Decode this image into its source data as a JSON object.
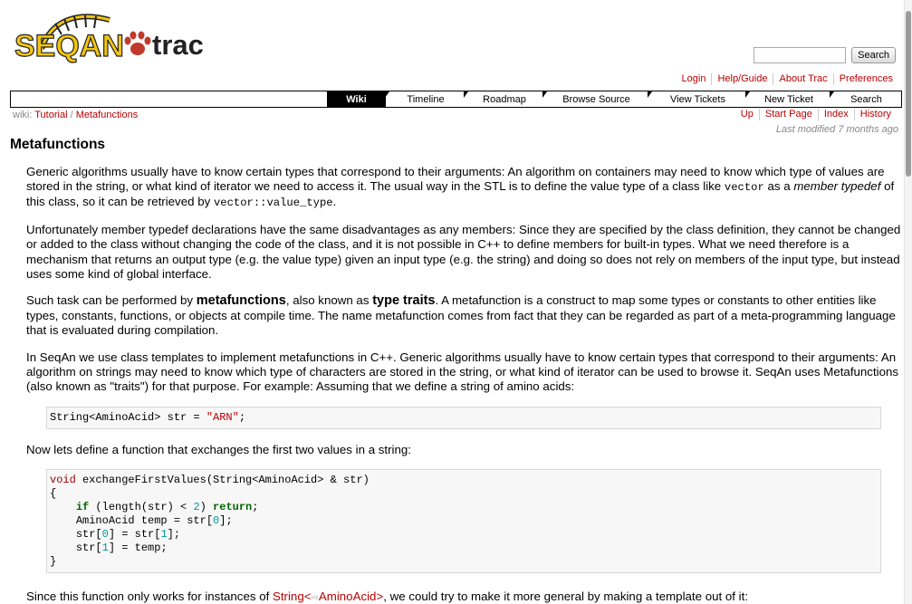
{
  "header": {
    "logo_text_seqan": "SEQAN",
    "logo_text_trac": "trac",
    "search_placeholder": "",
    "search_button": "Search"
  },
  "metanav": [
    "Login",
    "Help/Guide",
    "About Trac",
    "Preferences"
  ],
  "mainnav": [
    "Wiki",
    "Timeline",
    "Roadmap",
    "Browse Source",
    "View Tickets",
    "New Ticket",
    "Search"
  ],
  "ctxtnav": [
    "Up",
    "Start Page",
    "Index",
    "History"
  ],
  "lastmod": {
    "prefix": "Last modified",
    "ago": "7 months ago"
  },
  "pagepath": {
    "prefix": "wiki:",
    "crumb1": "Tutorial",
    "sep": "/",
    "crumb2": "Metafunctions"
  },
  "page_title": "Metafunctions",
  "content": {
    "p1": {
      "a": "Generic algorithms usually have to know certain types that correspond to their arguments: An algorithm on containers may need to know which type of values are stored in the string, or what kind of iterator we need to access it. The usual way in the STL is to define the value type of a class like ",
      "code1": "vector",
      "b": " as a ",
      "em": "member typedef",
      "c": " of this class, so it can be retrieved by ",
      "code2": "vector::value_type",
      "d": "."
    },
    "p2": "Unfortunately member typedef declarations have the same disadvantages as any members: Since they are specified by the class definition, they cannot be changed or added to the class without changing the code of the class, and it is not possible in C++ to define members for built-in types. What we need therefore is a mechanism that returns an output type (e.g. the value type) given an input type (e.g. the string) and doing so does not rely on members of the input type, but instead uses some kind of global interface.",
    "p3": {
      "a": "Such task can be performed by ",
      "strong1": "metafunctions",
      "b": ", also known as ",
      "strong2": "type traits",
      "c": ". A metafunction is a construct to map some types or constants to other entities like types, constants, functions, or objects at compile time. The name metafunction comes from fact that they can be regarded as part of a meta-programming language that is evaluated during compilation."
    },
    "p4": "In SeqAn we use class templates to implement metafunctions in C++. Generic algorithms usually have to know certain types that correspond to their arguments: An algorithm on strings may need to know which type of characters are stored in the string, or what kind of iterator can be used to browse it. SeqAn uses Metafunctions (also known as \"traits\") for that purpose. For example: Assuming that we define a string of amino acids:",
    "code1": {
      "type": "String<AminoAcid> str = ",
      "str": "\"ARN\"",
      "end": ";"
    },
    "p5": "Now lets define a function that exchanges the first two values in a string:",
    "code2": {
      "l1_kw": "void",
      "l1_rest": " exchangeFirstValues(String<AminoAcid> & str)",
      "l2": "{",
      "l3_if": "if",
      "l3_mid": " (length(str) < ",
      "l3_num": "2",
      "l3_paren": ") ",
      "l3_ret": "return",
      "l3_end": ";",
      "l4_a": "AminoAcid temp = str[",
      "l4_n": "0",
      "l4_b": "];",
      "l5_a": "str[",
      "l5_n1": "0",
      "l5_b": "] = str[",
      "l5_n2": "1",
      "l5_c": "];",
      "l6_a": "str[",
      "l6_n": "1",
      "l6_b": "] = temp;",
      "l7": "}"
    },
    "p6": {
      "a": "Since this function only works for instances of ",
      "link1": "String<",
      "link2": "AminoAcid>",
      "b": ", we could try to make it more general by making a template out of it:"
    }
  }
}
